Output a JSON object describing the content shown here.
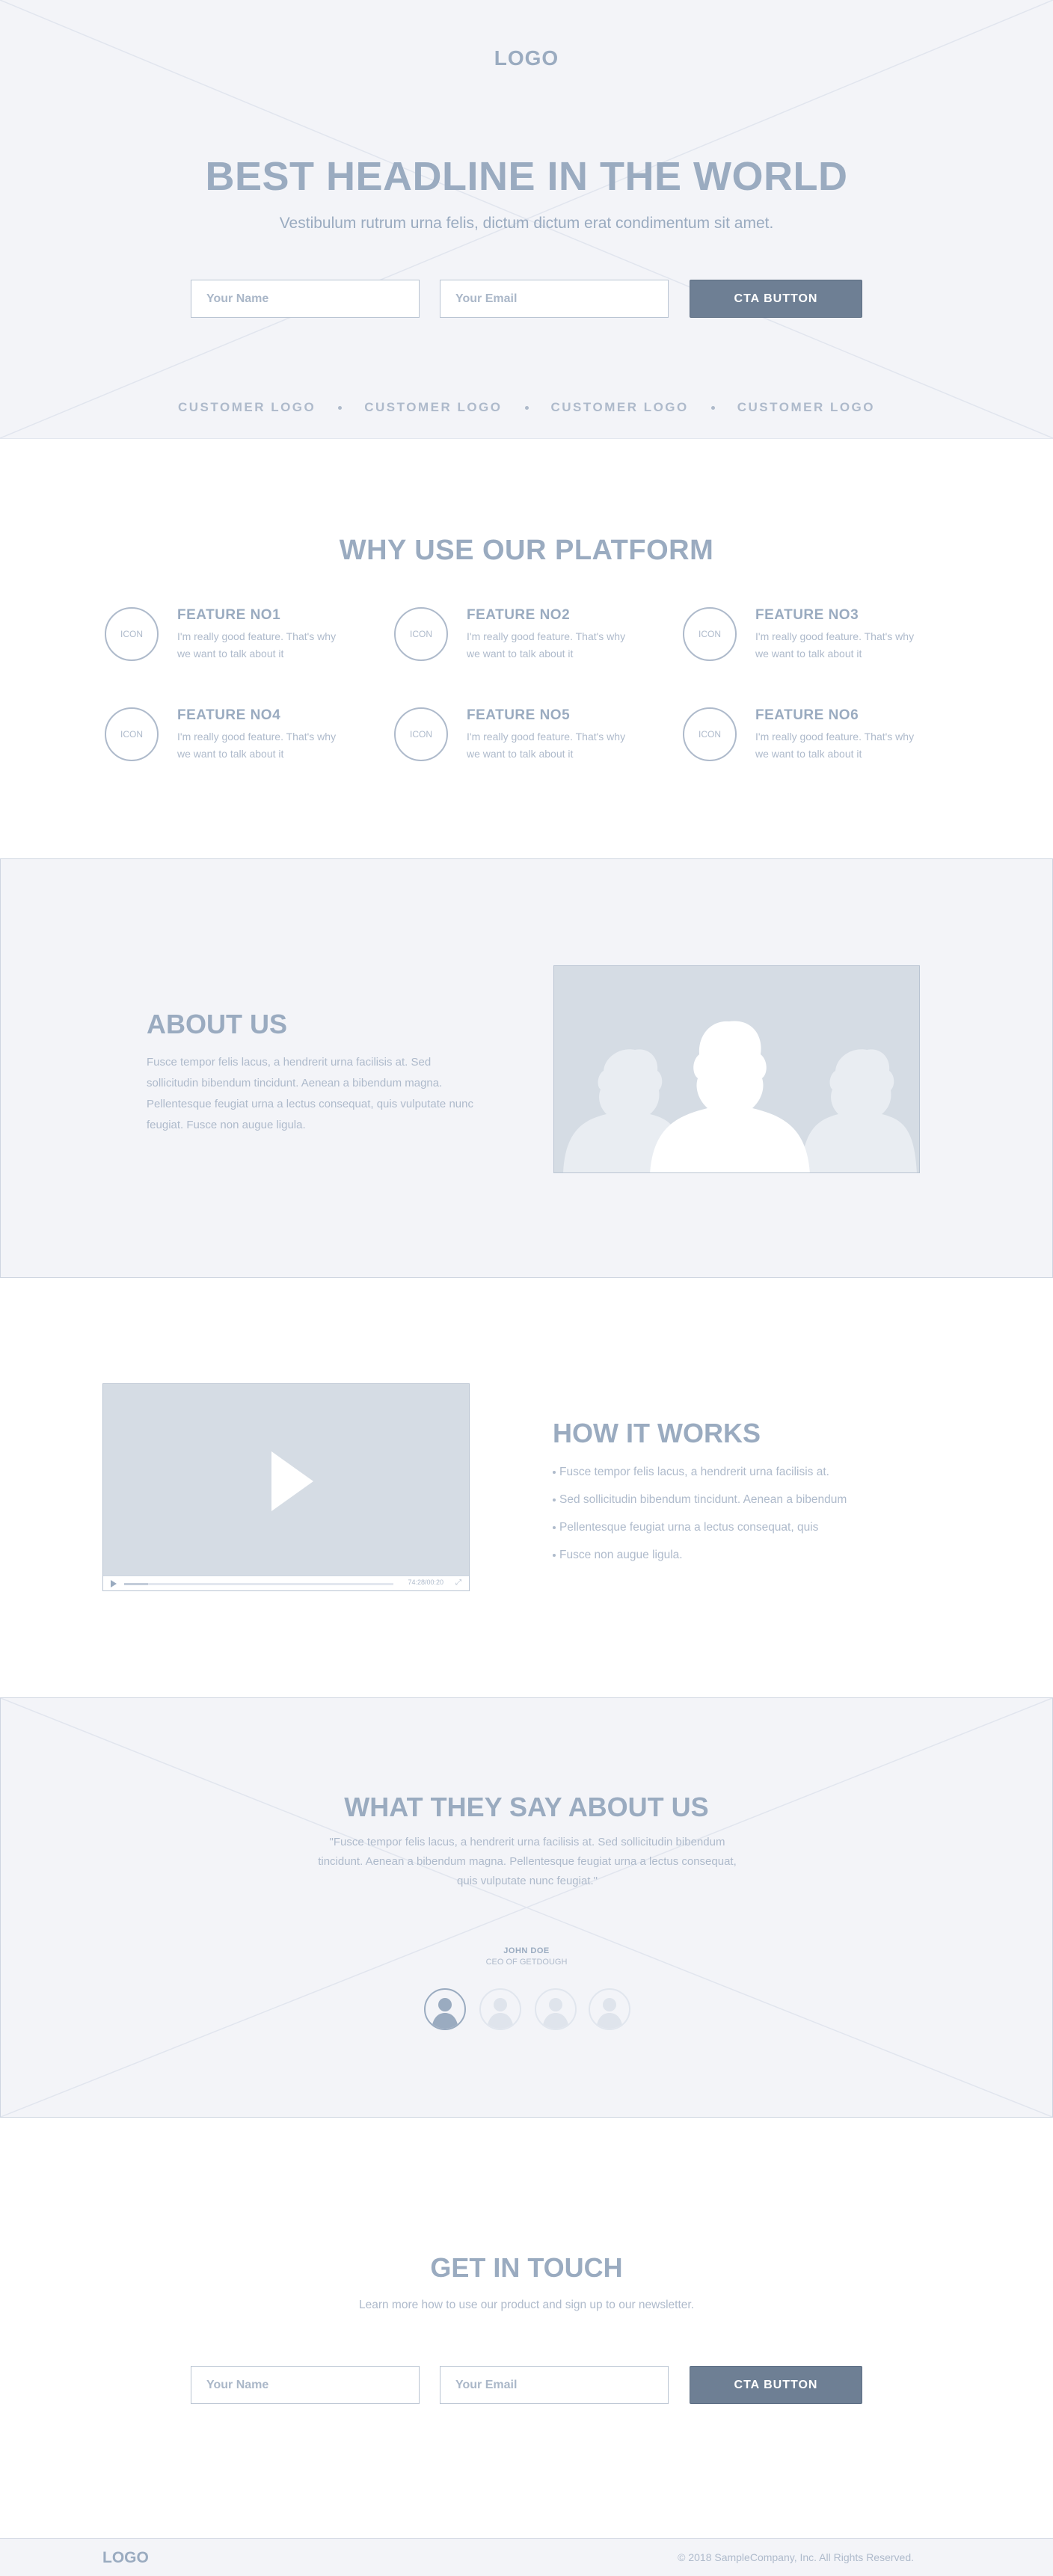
{
  "hero": {
    "logo": "LOGO",
    "headline": "BEST HEADLINE IN THE WORLD",
    "subheadline": "Vestibulum rutrum urna felis, dictum dictum erat condimentum sit amet.",
    "name_placeholder": "Your Name",
    "email_placeholder": "Your Email",
    "cta_label": "CTA BUTTON",
    "customer_logos": [
      "CUSTOMER LOGO",
      "CUSTOMER LOGO",
      "CUSTOMER LOGO",
      "CUSTOMER LOGO"
    ]
  },
  "features": {
    "title": "WHY USE OUR PLATFORM",
    "items": [
      {
        "icon": "ICON",
        "title": "FEATURE NO1",
        "desc": "I'm really good feature. That's why we want to talk about it"
      },
      {
        "icon": "ICON",
        "title": "FEATURE NO2",
        "desc": "I'm really good feature. That's why we want to talk about it"
      },
      {
        "icon": "ICON",
        "title": "FEATURE NO3",
        "desc": "I'm really good feature. That's why we want to talk about it"
      },
      {
        "icon": "ICON",
        "title": "FEATURE NO4",
        "desc": "I'm really good feature. That's why we want to talk about it"
      },
      {
        "icon": "ICON",
        "title": "FEATURE NO5",
        "desc": "I'm really good feature. That's why we want to talk about it"
      },
      {
        "icon": "ICON",
        "title": "FEATURE NO6",
        "desc": "I'm really good feature. That's why we want to talk about it"
      }
    ]
  },
  "about": {
    "title": "ABOUT US",
    "text": "Fusce tempor felis lacus, a hendrerit urna facilisis at. Sed sollicitudin bibendum tincidunt. Aenean a bibendum magna. Pellentesque feugiat urna a lectus consequat, quis vulputate nunc feugiat. Fusce non augue ligula."
  },
  "how_it_works": {
    "title": "HOW IT WORKS",
    "video_time": "74:28/00:20",
    "video_progress": 0.09,
    "items": [
      "Fusce tempor felis lacus, a hendrerit urna facilisis at.",
      "Sed sollicitudin bibendum tincidunt. Aenean a bibendum",
      "Pellentesque feugiat urna a lectus consequat, quis",
      "Fusce non augue ligula."
    ]
  },
  "testimonials": {
    "title": "WHAT THEY SAY ABOUT US",
    "quote": "\"Fusce tempor felis lacus, a hendrerit urna facilisis at. Sed sollicitudin bibendum tincidunt. Aenean a bibendum magna. Pellentesque feugiat urna a lectus consequat, quis vulputate nunc feugiat.\"",
    "name": "JOHN DOE",
    "role": "CEO OF GETDOUGH"
  },
  "contact": {
    "title": "GET IN TOUCH",
    "subtitle": "Learn more how to use our product and sign up to our newsletter.",
    "name_placeholder": "Your Name",
    "email_placeholder": "Your Email",
    "cta_label": "CTA BUTTON"
  },
  "footer": {
    "logo": "LOGO",
    "copyright": "© 2018 SampleCompany, Inc. All Rights Reserved."
  },
  "colors": {
    "accent": "#6e7f94",
    "text": "#9aabc0",
    "muted": "#aebacb",
    "panel": "#f3f4f8",
    "placeholder_fill": "#d5dce4"
  }
}
